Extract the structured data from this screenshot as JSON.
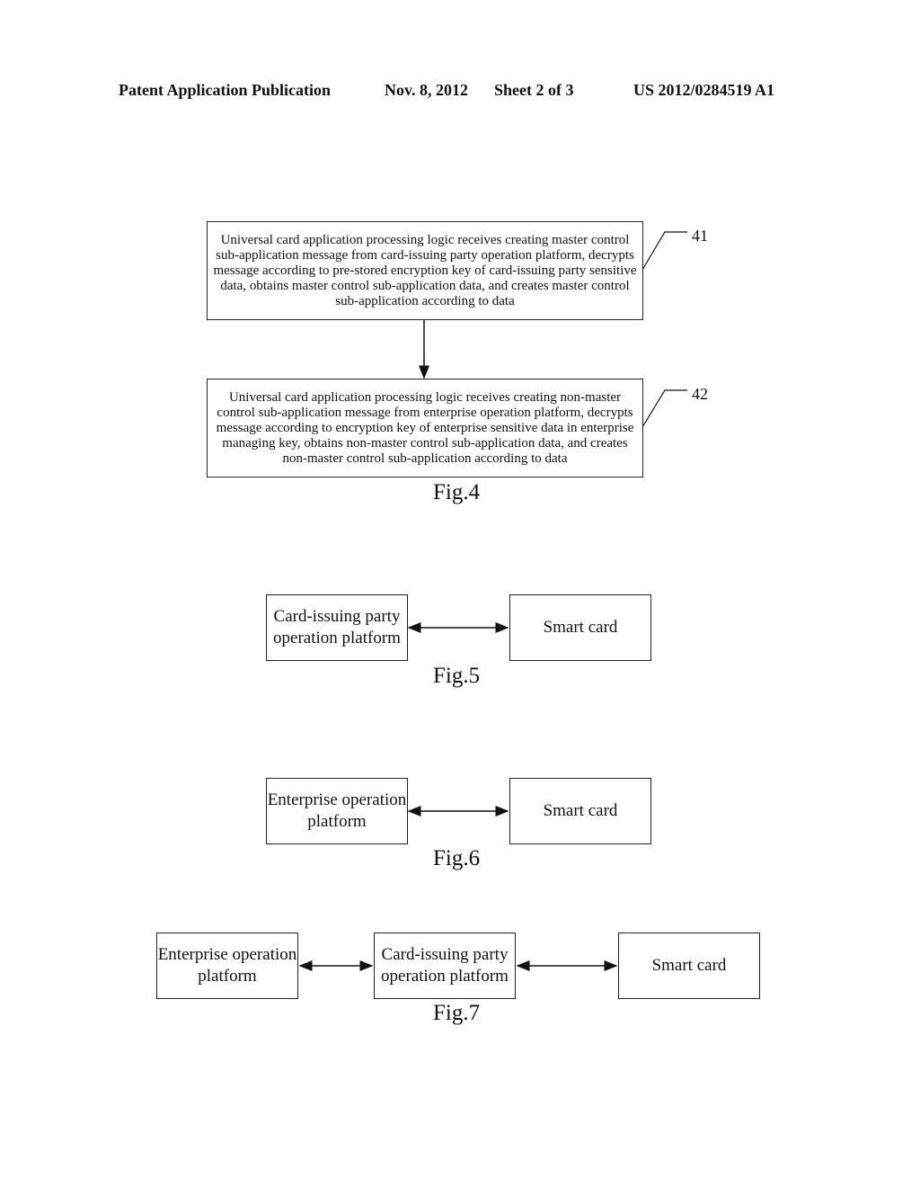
{
  "header": {
    "publication": "Patent Application Publication",
    "date": "Nov. 8, 2012",
    "sheet": "Sheet 2 of 3",
    "number": "US 2012/0284519 A1"
  },
  "fig4": {
    "caption": "Fig.4",
    "steps": [
      {
        "ref": "41",
        "text": "Universal card application processing logic receives creating master control sub-application message from card-issuing party operation platform, decrypts message according to pre-stored encryption key of card-issuing party sensitive data, obtains master control sub-application data, and creates master control sub-application according to data"
      },
      {
        "ref": "42",
        "text": "Universal card application processing logic receives creating non-master control sub-application message from enterprise operation platform, decrypts message according to encryption key of enterprise sensitive data in enterprise managing key, obtains non-master control sub-application data, and creates non-master control sub-application according to data"
      }
    ]
  },
  "fig5": {
    "caption": "Fig.5",
    "nodes": [
      "Card-issuing party operation platform",
      "Smart card"
    ]
  },
  "fig6": {
    "caption": "Fig.6",
    "nodes": [
      "Enterprise operation platform",
      "Smart card"
    ]
  },
  "fig7": {
    "caption": "Fig.7",
    "nodes": [
      "Enterprise operation platform",
      "Card-issuing party operation platform",
      "Smart card"
    ]
  }
}
